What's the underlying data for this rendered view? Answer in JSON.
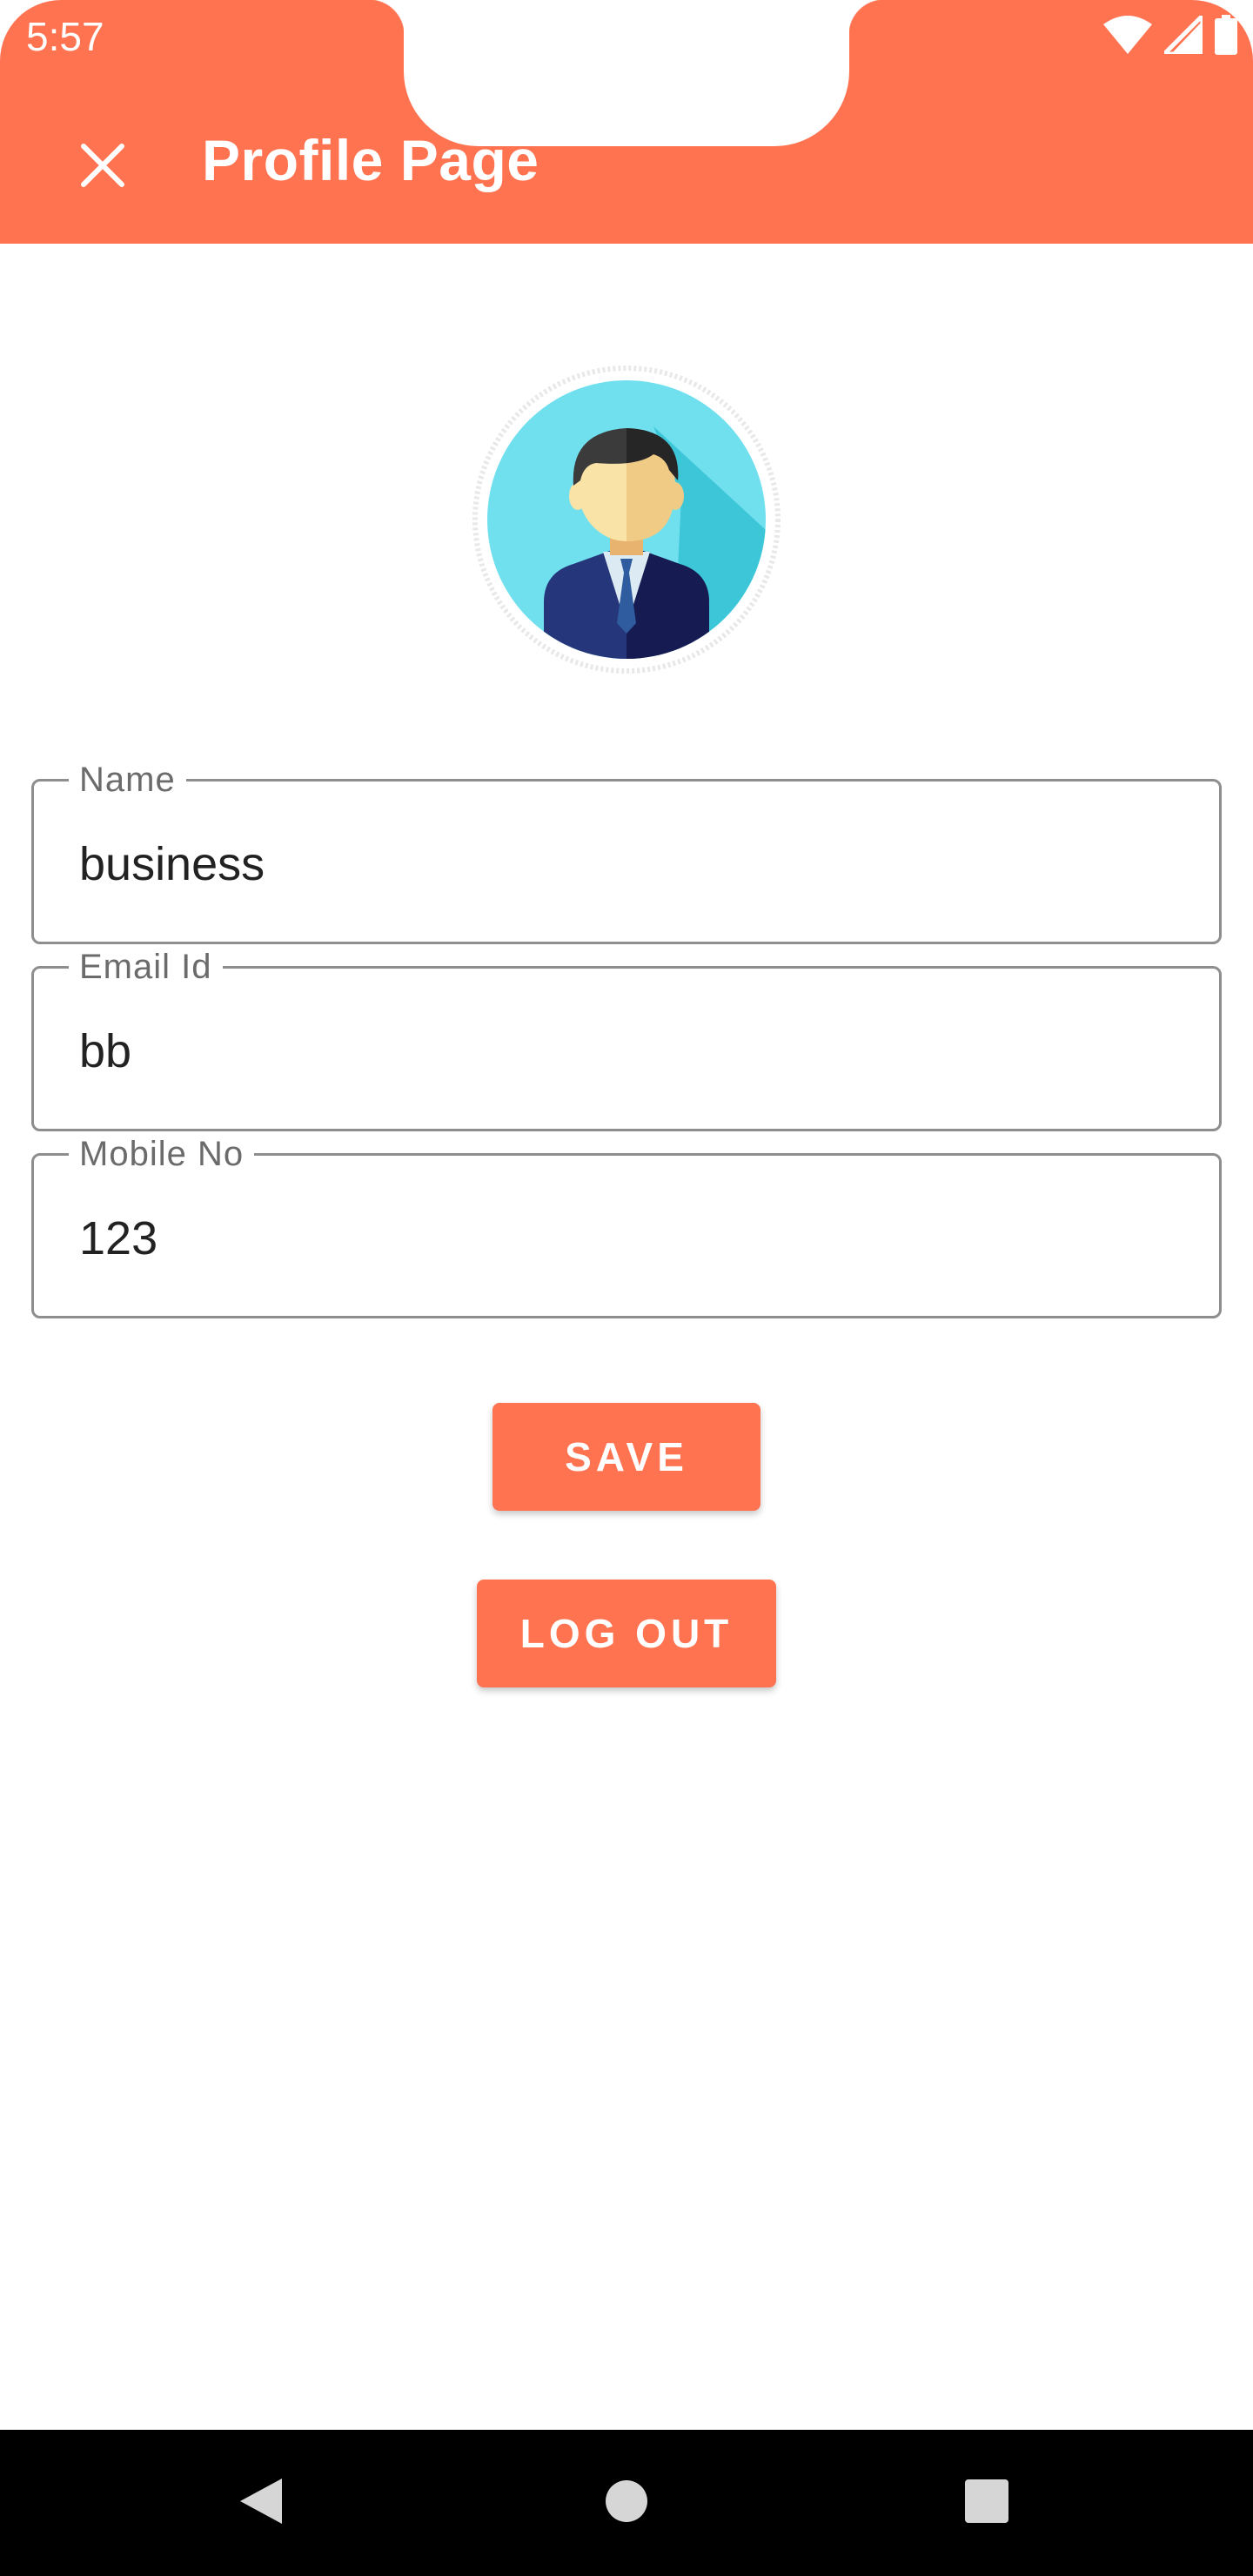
{
  "status_bar": {
    "time": "5:57",
    "icons": [
      "wifi-icon",
      "signal-icon",
      "battery-icon"
    ]
  },
  "app_bar": {
    "title": "Profile Page",
    "close_icon": "close-icon"
  },
  "profile": {
    "avatar_icon": "businessman-avatar"
  },
  "form": {
    "name": {
      "label": "Name",
      "value": "business"
    },
    "email": {
      "label": "Email Id",
      "value": "bb"
    },
    "mobile": {
      "label": "Mobile No",
      "value": "123"
    }
  },
  "buttons": {
    "save_label": "SAVE",
    "logout_label": "LOG OUT"
  },
  "nav_bar": {
    "icons": [
      "back-icon",
      "home-icon",
      "recents-icon"
    ]
  },
  "colors": {
    "accent": "#FF7350",
    "field_border": "#8E8E8E",
    "field_label": "#6B6B6B",
    "text": "#222222"
  }
}
